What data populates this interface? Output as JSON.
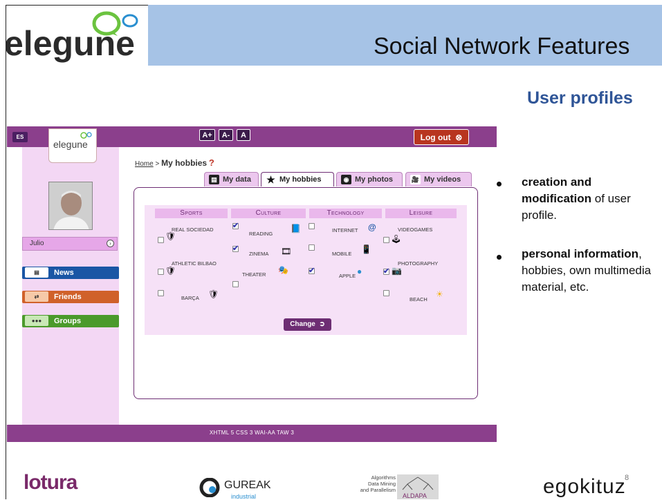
{
  "slide": {
    "logo_text": "elegune",
    "title": "Social Network Features",
    "subtitle": "User profiles",
    "number": "8"
  },
  "app": {
    "topbar": {
      "lang": "ES",
      "font_buttons": [
        "A+",
        "A-",
        "A"
      ],
      "logout_label": "Log out"
    },
    "sidebar": {
      "logo_text": "elegune",
      "user_name": "Julio",
      "nav": [
        {
          "label": "News",
          "icon": "newspaper-icon",
          "color": "#1a56a5"
        },
        {
          "label": "Friends",
          "icon": "handshake-icon",
          "color": "#d0612a"
        },
        {
          "label": "Groups",
          "icon": "group-icon",
          "color": "#4b9a2b"
        }
      ]
    },
    "breadcrumb": {
      "home": "Home",
      "separator": ">",
      "current": "My hobbies",
      "help": "?"
    },
    "tabs": [
      {
        "label": "My data",
        "icon": "newspaper-icon",
        "active": false
      },
      {
        "label": "My hobbies",
        "icon": "star-icon",
        "active": true
      },
      {
        "label": "My photos",
        "icon": "camera-icon",
        "active": false
      },
      {
        "label": "My videos",
        "icon": "video-camera-icon",
        "active": false
      }
    ],
    "hobbies": {
      "categories": [
        "Sports",
        "Culture",
        "Technology",
        "Leisure"
      ],
      "items": [
        {
          "category": "Sports",
          "label": "REAL SOCIEDAD",
          "checked": false,
          "icon": "football-shield-icon"
        },
        {
          "category": "Sports",
          "label": "ATHLETIC BILBAO",
          "checked": false,
          "icon": "football-shield-icon"
        },
        {
          "category": "Sports",
          "label": "BARÇA",
          "checked": false,
          "icon": "football-shield-icon"
        },
        {
          "category": "Culture",
          "label": "READING",
          "checked": true,
          "icon": "book-icon"
        },
        {
          "category": "Culture",
          "label": "ZINEMA",
          "checked": true,
          "icon": "film-icon"
        },
        {
          "category": "Culture",
          "label": "THEATER",
          "checked": false,
          "icon": "theater-masks-icon"
        },
        {
          "category": "Technology",
          "label": "INTERNET",
          "checked": false,
          "icon": "at-icon"
        },
        {
          "category": "Technology",
          "label": "MOBILE",
          "checked": false,
          "icon": "mobile-icon"
        },
        {
          "category": "Technology",
          "label": "APPLE",
          "checked": true,
          "icon": "apple-icon"
        },
        {
          "category": "Leisure",
          "label": "VIDEOGAMES",
          "checked": false,
          "icon": "joystick-icon"
        },
        {
          "category": "Leisure",
          "label": "PHOTOGRAPHY",
          "checked": true,
          "icon": "camera-icon"
        },
        {
          "category": "Leisure",
          "label": "BEACH",
          "checked": false,
          "icon": "sun-icon"
        }
      ],
      "change_label": "Change"
    },
    "footer": "XHTML 5   CSS 3   WAI-AA   TAW 3"
  },
  "bullets": [
    {
      "bold": "creation and modification",
      "rest": " of user profile."
    },
    {
      "bold": "personal information",
      "rest": ", hobbies, own multimedia material, etc."
    }
  ],
  "partner_logos": {
    "lotura": "lotura",
    "gureak": "GUREAK",
    "gureak_sub": "industrial",
    "aldapa_lines": [
      "Algorithms",
      "Data Mining",
      "and Parallelism"
    ],
    "aldapa_name": "ALDAPA",
    "egokituz": "egokituz"
  }
}
